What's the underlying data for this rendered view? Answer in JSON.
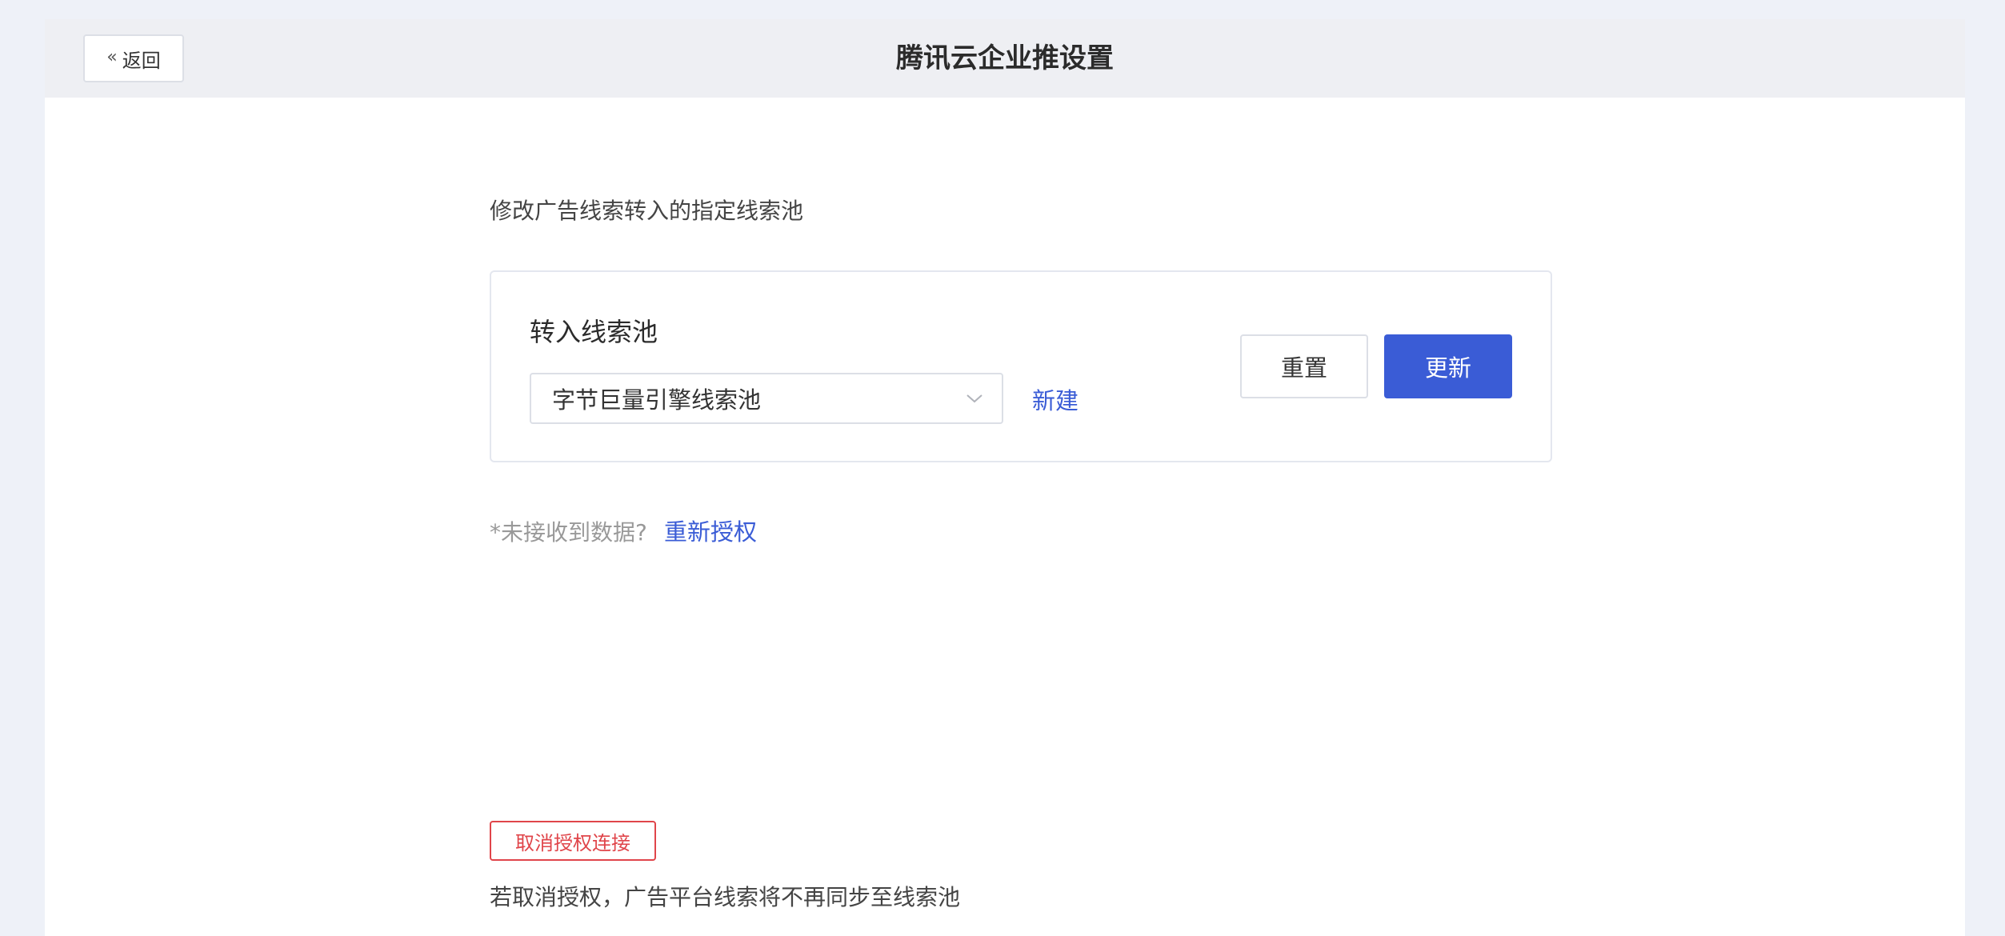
{
  "header": {
    "back_label": "返回",
    "back_icon": "double-chevron-left-icon",
    "title": "腾讯云企业推设置"
  },
  "main": {
    "subtitle": "修改广告线索转入的指定线索池",
    "pool_card": {
      "label": "转入线索池",
      "select_value": "字节巨量引擎线索池",
      "select_icon": "chevron-down-icon",
      "new_link": "新建",
      "reset_label": "重置",
      "update_label": "更新"
    },
    "hint": {
      "text": "*未接收到数据?",
      "reauth_link": "重新授权"
    },
    "revoke": {
      "button_label": "取消授权连接",
      "note": "若取消授权，广告平台线索将不再同步至线索池"
    }
  },
  "colors": {
    "primary": "#3a5cd6",
    "danger": "#e0454a",
    "page_bg": "#eef1f8",
    "header_bg": "#eeeff3"
  }
}
